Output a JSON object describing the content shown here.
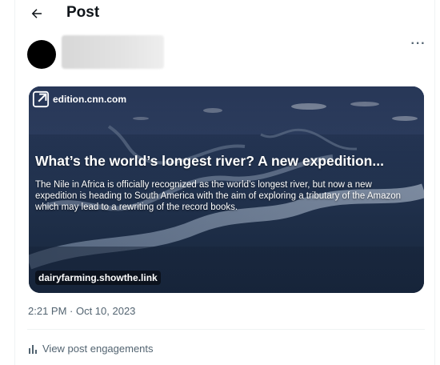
{
  "header": {
    "title": "Post",
    "back_icon": "arrow-left-icon"
  },
  "author": {
    "more_label": "···",
    "more_icon": "more-icon"
  },
  "card": {
    "domain": "edition.cnn.com",
    "headline": "What’s the world’s longest river? A new expedition...",
    "description": "The Nile in Africa is officially recognized as the world’s longest river, but now a new expedition is heading to South America with the aim of exploring a tributary of the Amazon which may lead to a rewriting of the record books.",
    "link": "dairyfarming.showthe.link",
    "external_icon": "external-link-icon"
  },
  "post": {
    "timestamp": "2:21 PM · Oct 10, 2023",
    "engagements_label": "View post engagements",
    "engagements_icon": "analytics-icon"
  }
}
